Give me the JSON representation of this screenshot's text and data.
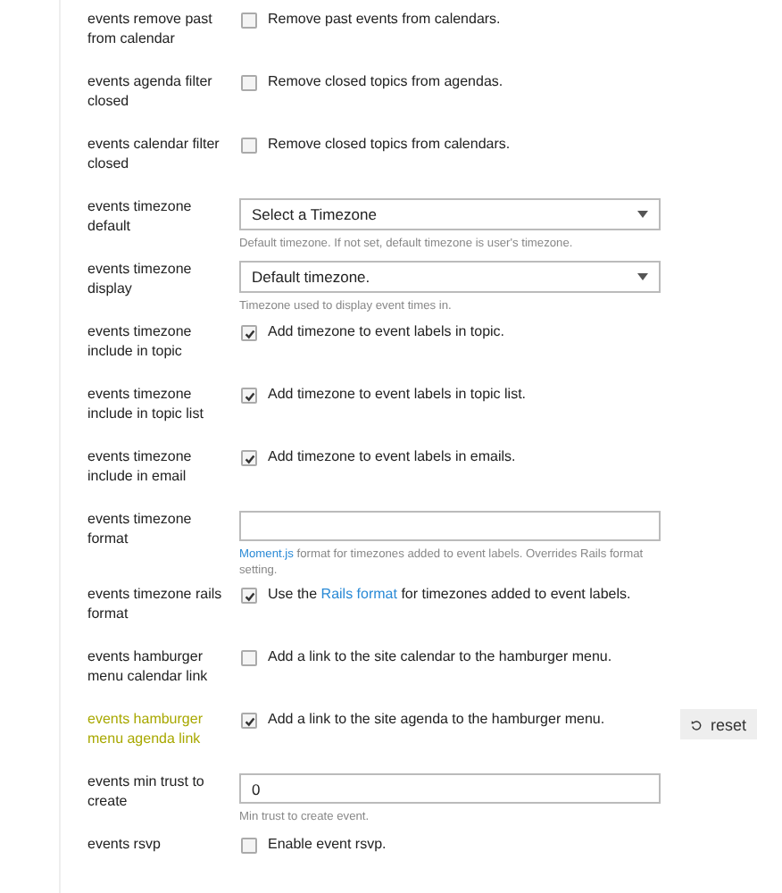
{
  "settings": [
    {
      "label": "events remove past from calendar",
      "kind": "checkbox",
      "checked": false,
      "overridden": false,
      "text": "Remove past events from calendars."
    },
    {
      "label": "events agenda filter closed",
      "kind": "checkbox",
      "checked": false,
      "overridden": false,
      "text": "Remove closed topics from agendas."
    },
    {
      "label": "events calendar filter closed",
      "kind": "checkbox",
      "checked": false,
      "overridden": false,
      "text": "Remove closed topics from calendars."
    },
    {
      "label": "events timezone default",
      "kind": "select",
      "overridden": false,
      "value": "Select a Timezone",
      "description": "Default timezone. If not set, default timezone is user's timezone."
    },
    {
      "label": "events timezone display",
      "kind": "select",
      "overridden": false,
      "value": "Default timezone.",
      "description": "Timezone used to display event times in."
    },
    {
      "label": "events timezone include in topic",
      "kind": "checkbox",
      "checked": true,
      "overridden": false,
      "text": "Add timezone to event labels in topic."
    },
    {
      "label": "events timezone include in topic list",
      "kind": "checkbox",
      "checked": true,
      "overridden": false,
      "text": "Add timezone to event labels in topic list."
    },
    {
      "label": "events timezone include in email",
      "kind": "checkbox",
      "checked": true,
      "overridden": false,
      "text": "Add timezone to event labels in emails."
    },
    {
      "label": "events timezone format",
      "kind": "text",
      "overridden": false,
      "description_link": "Moment.js",
      "description": "format for timezones added to event labels. Overrides Rails format setting."
    },
    {
      "label": "events timezone rails format",
      "kind": "checkbox",
      "checked": true,
      "overridden": false,
      "text_before": "Use the",
      "text_link": "Rails format",
      "text": "for timezones added to event labels."
    },
    {
      "label": "events hamburger menu calendar link",
      "kind": "checkbox",
      "checked": false,
      "overridden": false,
      "text": "Add a link to the site calendar to the hamburger menu."
    },
    {
      "label": "events hamburger menu agenda link",
      "kind": "checkbox",
      "checked": true,
      "overridden": true,
      "text": "Add a link to the site agenda to the hamburger menu.",
      "reset_label": "reset"
    },
    {
      "label": "events min trust to create",
      "kind": "text",
      "overridden": false,
      "value": "0",
      "description": "Min trust to create event."
    },
    {
      "label": "events rsvp",
      "kind": "checkbox",
      "checked": false,
      "overridden": false,
      "text": "Enable event rsvp."
    }
  ]
}
